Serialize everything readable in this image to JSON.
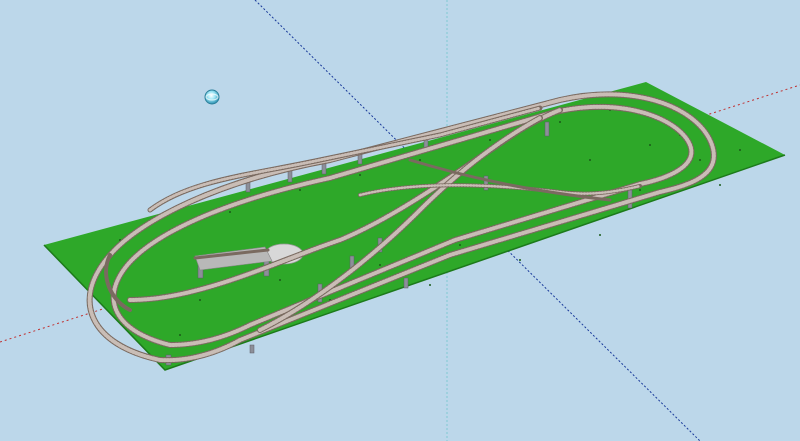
{
  "viewport": {
    "background": "#bcd7ea",
    "board_color": "#2ea829",
    "board_edge_color": "#1d7a1b",
    "rail_color": "#7a6a60",
    "sleeper_color": "#b7a8a0",
    "pillar_color": "#8c8f99",
    "turntable_color": "#d8d8d8",
    "axis_colors": {
      "red": "#cc3333",
      "green": "#33aa55",
      "blue": "#3355cc"
    }
  },
  "tools": {
    "orbit_icon": "orbit-icon"
  }
}
